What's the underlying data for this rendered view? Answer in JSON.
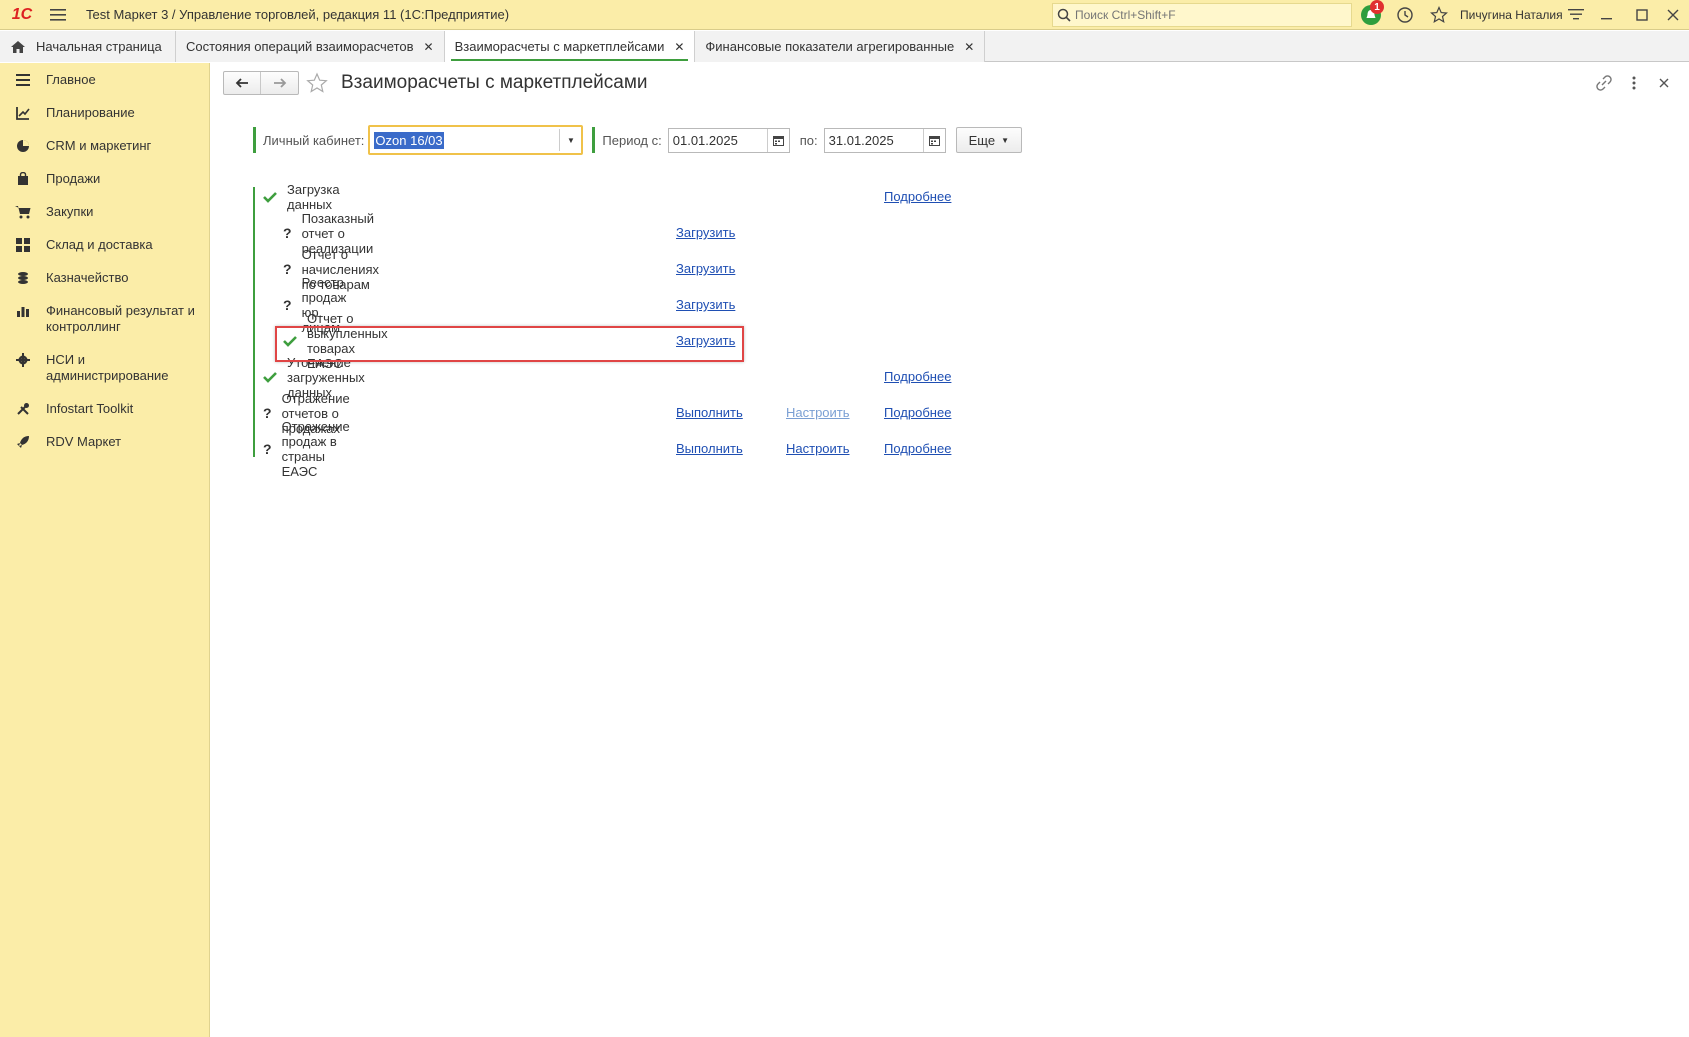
{
  "titlebar": {
    "logo": "1С",
    "app_title": "Test Маркет 3 / Управление торговлей, редакция 11  (1С:Предприятие)",
    "search_placeholder": "Поиск Ctrl+Shift+F",
    "notification_count": "1",
    "user_name": "Пичугина Наталия"
  },
  "tabs": [
    {
      "label": "Начальная страница",
      "closable": false,
      "active": false
    },
    {
      "label": "Состояния операций взаиморасчетов",
      "closable": true,
      "active": false
    },
    {
      "label": "Взаиморасчеты с маркетплейсами",
      "closable": true,
      "active": true
    },
    {
      "label": "Финансовые показатели агрегированные",
      "closable": true,
      "active": false
    }
  ],
  "sidebar": {
    "items": [
      {
        "label": "Главное",
        "icon": "menu-lines-icon"
      },
      {
        "label": "Планирование",
        "icon": "planning-icon"
      },
      {
        "label": "CRM и маркетинг",
        "icon": "pie-chart-icon"
      },
      {
        "label": "Продажи",
        "icon": "shopping-bag-icon"
      },
      {
        "label": "Закупки",
        "icon": "cart-icon"
      },
      {
        "label": "Склад и доставка",
        "icon": "grid-icon"
      },
      {
        "label": "Казначейство",
        "icon": "coins-icon"
      },
      {
        "label": "Финансовый результат и контроллинг",
        "icon": "bar-chart-icon"
      },
      {
        "label": "НСИ и администрирование",
        "icon": "gear-icon"
      },
      {
        "label": "Infostart Toolkit",
        "icon": "tools-icon"
      },
      {
        "label": "RDV Маркет",
        "icon": "rocket-icon"
      }
    ]
  },
  "form": {
    "title": "Взаиморасчеты с маркетплейсами",
    "account_label": "Личный кабинет:",
    "account_value": "Ozon 16/03",
    "period_from_label": "Период с:",
    "period_from": "01.01.2025",
    "period_to_label": "по:",
    "period_to": "31.01.2025",
    "more_label": "Еще"
  },
  "steps": [
    {
      "status": "done",
      "label": "Загрузка данных",
      "details": "Подробнее"
    },
    {
      "status": "unknown",
      "label": "Позаказный отчет о реализации",
      "action": "Загрузить"
    },
    {
      "status": "unknown",
      "label": "Отчет о начислениях по товарам",
      "action": "Загрузить"
    },
    {
      "status": "unknown",
      "label": "Реестр продаж юр. лицам",
      "action": "Загрузить"
    },
    {
      "status": "done",
      "label": "Отчет о выкупленных товарах ЕАЭС",
      "action": "Загрузить",
      "highlighted": true
    },
    {
      "status": "done",
      "label": "Уточнение загруженных данных",
      "details": "Подробнее"
    },
    {
      "status": "unknown",
      "label": "Отражение отчетов о продажах",
      "action": "Выполнить",
      "setup": "Настроить",
      "setup_disabled": true,
      "details": "Подробнее"
    },
    {
      "status": "unknown",
      "label": "Отражение продаж в страны ЕАЭС",
      "action": "Выполнить",
      "setup": "Настроить",
      "details": "Подробнее"
    }
  ],
  "colors": {
    "panel_yellow": "#fbeda8",
    "accent_green": "#3e9e3e",
    "link_blue": "#1f4fb3",
    "highlight_red": "#e04545",
    "focus_orange": "#f0c24a"
  }
}
